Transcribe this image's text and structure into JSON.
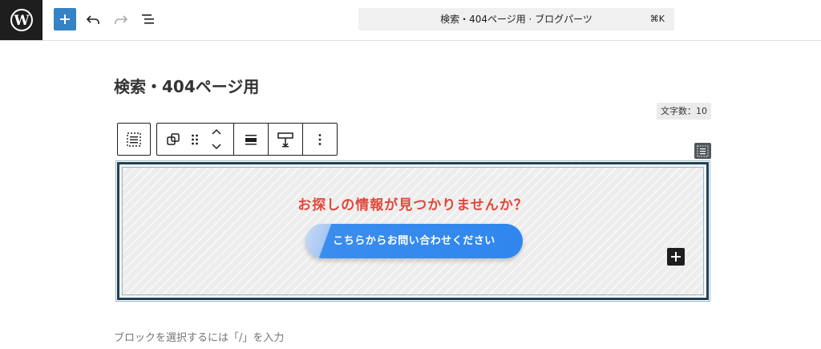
{
  "header": {
    "command_bar_title": "検索・404ページ用 · ブログパーツ",
    "command_bar_shortcut": "⌘K"
  },
  "post": {
    "title": "検索・404ページ用",
    "char_count": "文字数：10"
  },
  "block": {
    "heading": "お探しの情報が見つかりませんか？",
    "button_label": "こちらからお問い合わせください"
  },
  "placeholder": "ブロックを選択するには「/」を入力",
  "colors": {
    "accent": "#3582c4",
    "heading_red": "#e0473a",
    "button_blue": "#2f86ee",
    "selection_border": "#1d4257"
  },
  "icons": [
    "wordpress-logo-icon",
    "plus-icon",
    "undo-icon",
    "redo-icon",
    "document-overview-icon",
    "group-icon",
    "transform-icon",
    "drag-handle-icon",
    "chevron-up-icon",
    "chevron-down-icon",
    "align-icon",
    "height-icon",
    "more-vertical-icon",
    "block-appender-icon"
  ]
}
